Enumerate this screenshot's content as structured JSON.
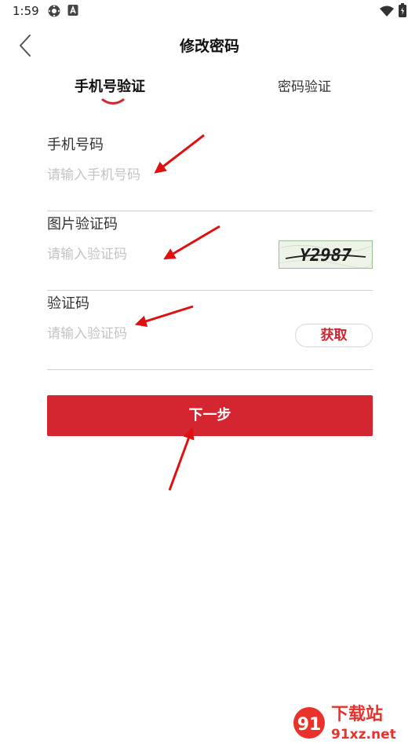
{
  "status_bar": {
    "time": "1:59"
  },
  "header": {
    "title": "修改密码"
  },
  "tabs": [
    {
      "label": "手机号验证",
      "active": true
    },
    {
      "label": "密码验证",
      "active": false
    }
  ],
  "form": {
    "phone": {
      "label": "手机号码",
      "placeholder": "请输入手机号码"
    },
    "image_code": {
      "label": "图片验证码",
      "placeholder": "请输入验证码",
      "captcha_text": "Y2987"
    },
    "sms_code": {
      "label": "验证码",
      "placeholder": "请输入验证码",
      "button_label": "获取"
    }
  },
  "next_button": {
    "label": "下一步"
  },
  "watermark": {
    "text_top": "下载站",
    "text_bottom": "91xz.net"
  },
  "colors": {
    "accent": "#d42630",
    "placeholder": "#c4c4c4",
    "divider": "#cfcfcf",
    "annotation_arrow": "#e01010"
  },
  "icons": [
    "settings-icon",
    "font-icon",
    "wifi-icon",
    "battery-icon",
    "back-chevron-icon"
  ]
}
